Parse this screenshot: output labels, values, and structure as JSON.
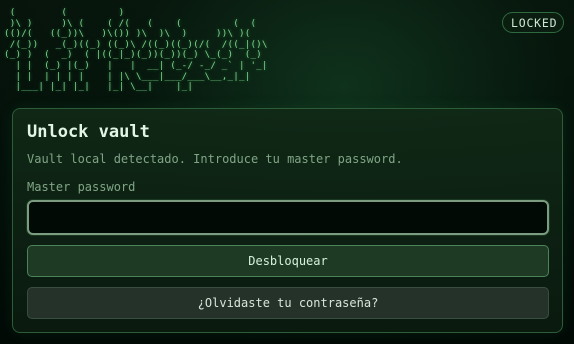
{
  "header": {
    "ascii_logo": " (        (         )\n )\\ )     )\\ (    ( /(   (    (         (  (\n(()/(   ((_))\\   )\\()) )\\  )\\  )     ))\\ )(\n /(_))   _(_)((_) ((_)\\ /((_)((_)(/(  /((_|()\\\n(_) )  (  _)  ( |((_|_)(_))(_))(_) \\_(_)  (_)\n  | |  (_) |(_)   |   |  __| (_-/ -_/ _` | '_|\n  | |  | | | |    | |\\ \\___|___/___\\__,_|_|\n  |___| |_| |_|   |_| \\__|    |_|",
    "status_badge": "LOCKED"
  },
  "card": {
    "title": "Unlock vault",
    "description": "Vault local detectado. Introduce tu master password.",
    "field_label": "Master password",
    "password_value": "",
    "password_placeholder": "",
    "unlock_label": "Desbloquear",
    "forgot_label": "¿Olvidaste tu contraseña?"
  },
  "colors": {
    "accent": "#4b8459",
    "background": "#020805",
    "text_primary": "#e3f6e5",
    "text_muted": "#7fa586"
  }
}
